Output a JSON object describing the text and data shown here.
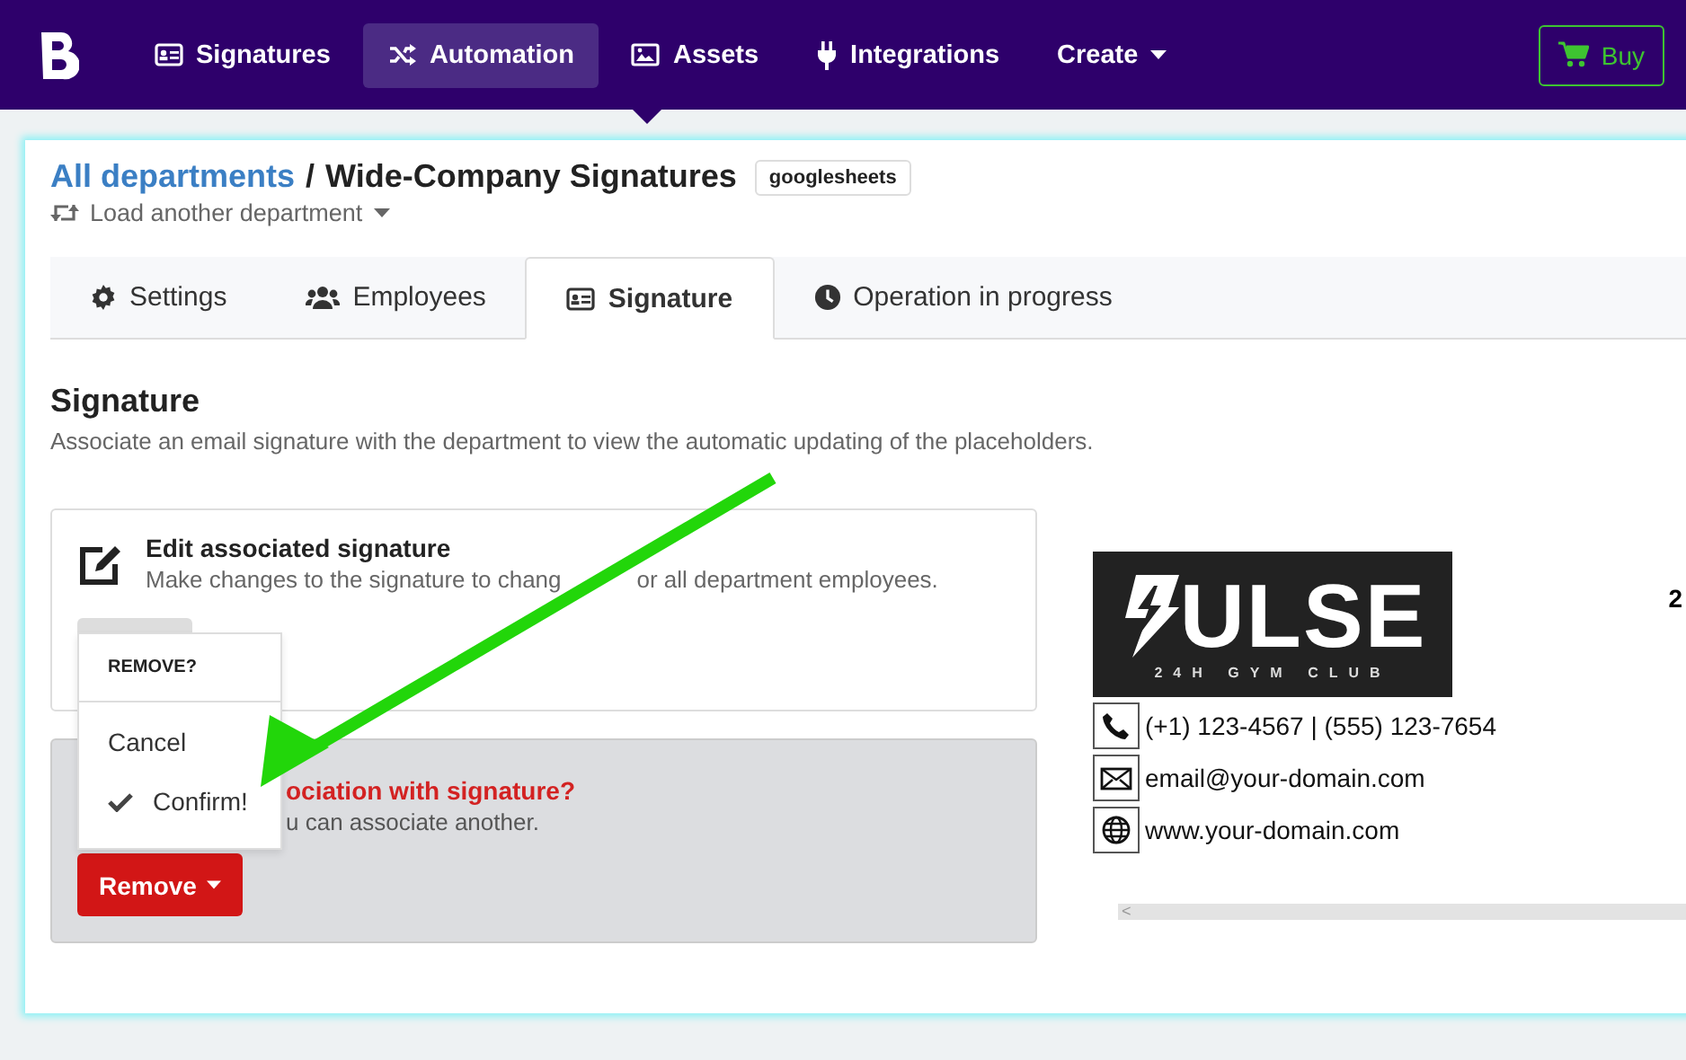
{
  "nav": {
    "items": [
      {
        "label": "Signatures",
        "selected": false
      },
      {
        "label": "Automation",
        "selected": true
      },
      {
        "label": "Assets",
        "selected": false
      },
      {
        "label": "Integrations",
        "selected": false
      },
      {
        "label": "Create",
        "selected": false
      }
    ],
    "buy": "Buy"
  },
  "breadcrumb": {
    "link": "All departments",
    "separator": "/",
    "title": "Wide-Company Signatures",
    "badge": "googlesheets",
    "switch": "Load another department"
  },
  "tabs": [
    {
      "label": "Settings",
      "selected": false
    },
    {
      "label": "Employees",
      "selected": false
    },
    {
      "label": "Signature",
      "selected": true
    },
    {
      "label": "Operation in progress",
      "selected": false
    }
  ],
  "section": {
    "title": "Signature",
    "description": "Associate an email signature with the department to view the automatic updating of the placeholders."
  },
  "edit_card": {
    "title": "Edit associated signature",
    "description_parts": [
      "Make changes to the signature to chang",
      "or all department employees."
    ]
  },
  "remove_card": {
    "title": "ociation with signature?",
    "description": "u can associate another.",
    "button": "Remove"
  },
  "menu": {
    "header": "REMOVE?",
    "items": [
      {
        "label": "Cancel",
        "checked": false
      },
      {
        "label": "Confirm!",
        "checked": true
      }
    ]
  },
  "preview": {
    "logo": {
      "text": "ULSE",
      "tagline": "24H GYM CLUB"
    },
    "contacts": [
      {
        "kind": "phone",
        "text": "(+1) 123-4567 | (555) 123-7654"
      },
      {
        "kind": "email",
        "text": "email@your-domain.com"
      },
      {
        "kind": "web",
        "text": "www.your-domain.com"
      }
    ],
    "cut_text": "2",
    "scroll_arrow": "<"
  }
}
